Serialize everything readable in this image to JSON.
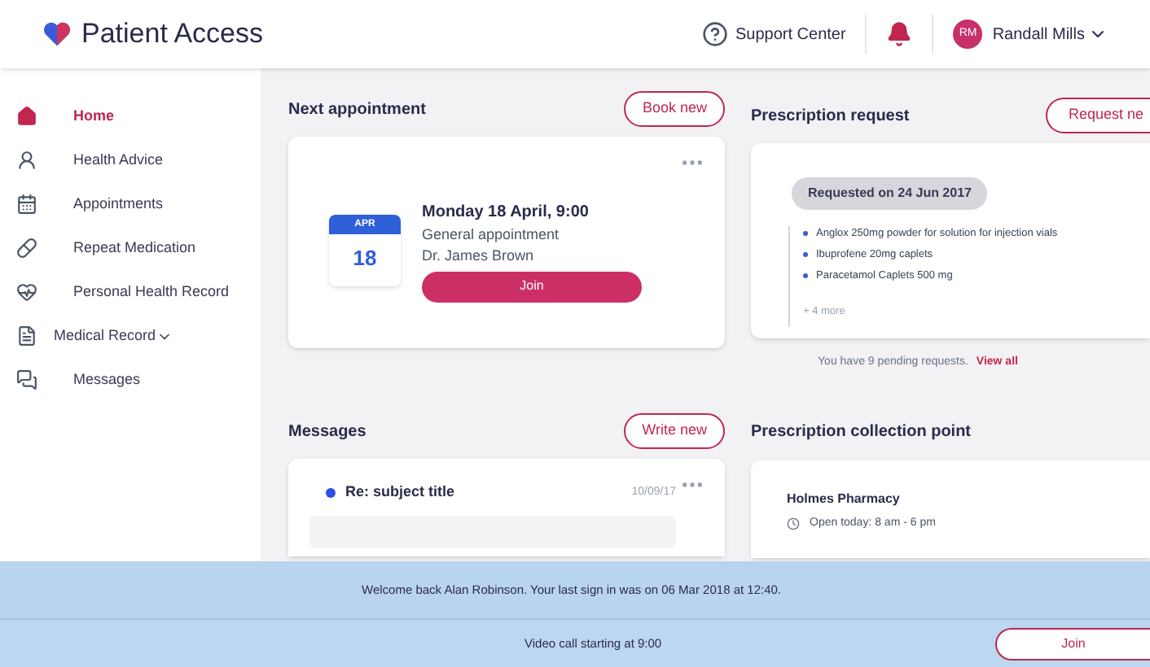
{
  "header": {
    "brand": "Patient Access",
    "support": "Support Center",
    "user_initials": "RM",
    "user_name": "Randall Mills"
  },
  "sidebar": {
    "items": [
      {
        "label": "Home",
        "kind": "link",
        "selected": true
      },
      {
        "label": "Health Advice",
        "kind": "link",
        "selected": false
      },
      {
        "label": "Appointments",
        "kind": "link",
        "selected": false
      },
      {
        "label": "Repeat Medication",
        "kind": "link",
        "selected": false
      },
      {
        "label": "Personal Health Record",
        "kind": "link",
        "selected": false
      },
      {
        "label": "Medical Record",
        "kind": "dropdown",
        "selected": false
      },
      {
        "label": "Messages",
        "kind": "link",
        "selected": false
      }
    ]
  },
  "next_appointment": {
    "title": "Next appointment",
    "action": "Book new",
    "month": "APR",
    "day": "18",
    "when": "Monday 18 April, 9:00",
    "type": "General appointment",
    "doctor": "Dr. James Brown",
    "join": "Join"
  },
  "prescription_request": {
    "title": "Prescription request",
    "action": "Request ne",
    "requested": "Requested on 24 Jun 2017",
    "items": [
      "Anglox 250mg powder for solution for injection vials",
      "Ibuprofene 20mg caplets",
      "Paracetamol Caplets 500 mg"
    ],
    "more": "+ 4 more",
    "pending": "You have 9 pending requests.",
    "view_all": "View all"
  },
  "messages": {
    "title": "Messages",
    "action": "Write new",
    "subject": "Re: subject title",
    "date": "10/09/17",
    "unread": true
  },
  "collection_point": {
    "title": "Prescription collection point",
    "pharmacy": "Holmes Pharmacy",
    "hours": "Open today: 8 am - 6 pm"
  },
  "welcome_banner": "Welcome back Alan Robinson. Your last sign in was on 06 Mar 2018 at 12:40.",
  "video_banner": {
    "text": "Video call starting at 9:00",
    "join": "Join"
  }
}
